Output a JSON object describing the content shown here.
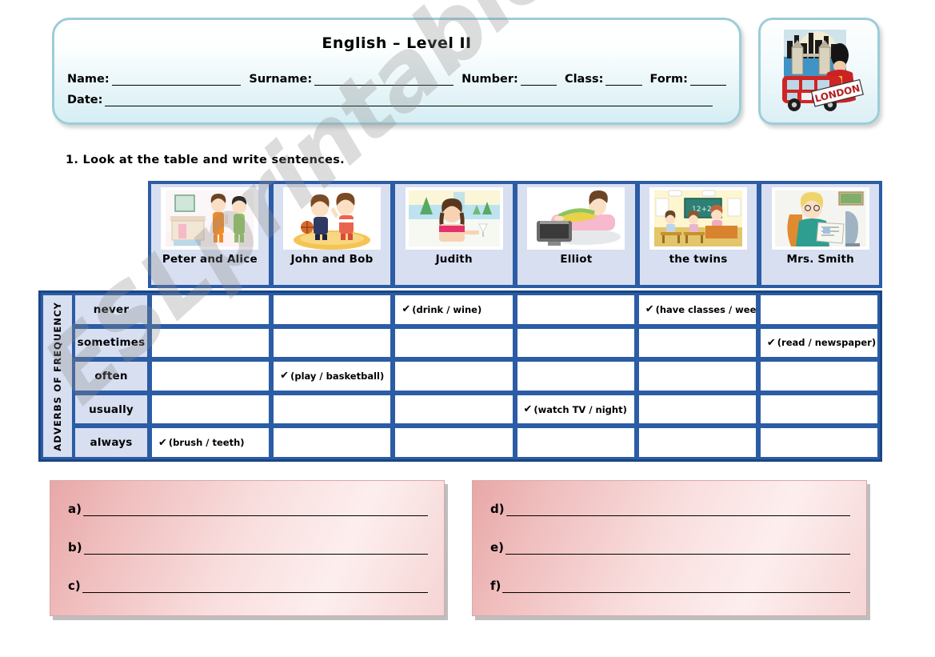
{
  "header": {
    "title": "English – Level II",
    "fields": [
      {
        "label": "Name:"
      },
      {
        "label": "Surname:"
      },
      {
        "label": "Number:"
      },
      {
        "label": "Class:"
      },
      {
        "label": "Form:"
      },
      {
        "label": "Date:"
      }
    ],
    "illustration_alt": "london-illustration",
    "illustration_banner": "LONDON"
  },
  "instruction": "1. Look at the table and write sentences.",
  "table": {
    "row_group_label": "ADVERBS OF FREQUENCY",
    "people": [
      {
        "name": "Peter and Alice",
        "scene": "children-brushing-teeth-bathroom"
      },
      {
        "name": "John and Bob",
        "scene": "boys-playing-basketball"
      },
      {
        "name": "Judith",
        "scene": "woman-at-beach-with-drink"
      },
      {
        "name": "Elliot",
        "scene": "man-lying-on-sofa-watching-tv"
      },
      {
        "name": "the twins",
        "scene": "children-in-classroom"
      },
      {
        "name": "Mrs. Smith",
        "scene": "woman-reading-newspaper"
      }
    ],
    "adverbs": [
      "never",
      "sometimes",
      "often",
      "usually",
      "always"
    ],
    "check_glyph": "✔",
    "cells": [
      [
        "",
        "",
        "(drink / wine)",
        "",
        "(have classes / weekend)",
        ""
      ],
      [
        "",
        "",
        "",
        "",
        "",
        "(read / newspaper)"
      ],
      [
        "",
        "(play / basketball)",
        "",
        "",
        "",
        ""
      ],
      [
        "",
        "",
        "",
        "(watch TV / night)",
        "",
        ""
      ],
      [
        "(brush / teeth)",
        "",
        "",
        "",
        "",
        ""
      ]
    ]
  },
  "answers": {
    "left": [
      "a)",
      "b)",
      "c)"
    ],
    "right": [
      "d)",
      "e)",
      "f)"
    ]
  },
  "watermark": "ESLprintables.com",
  "colors": {
    "table_border": "#2b5ca5",
    "header_cell": "#d7dff1",
    "box_border": "#9ccdd8",
    "answer_box": "#f0bebe"
  }
}
